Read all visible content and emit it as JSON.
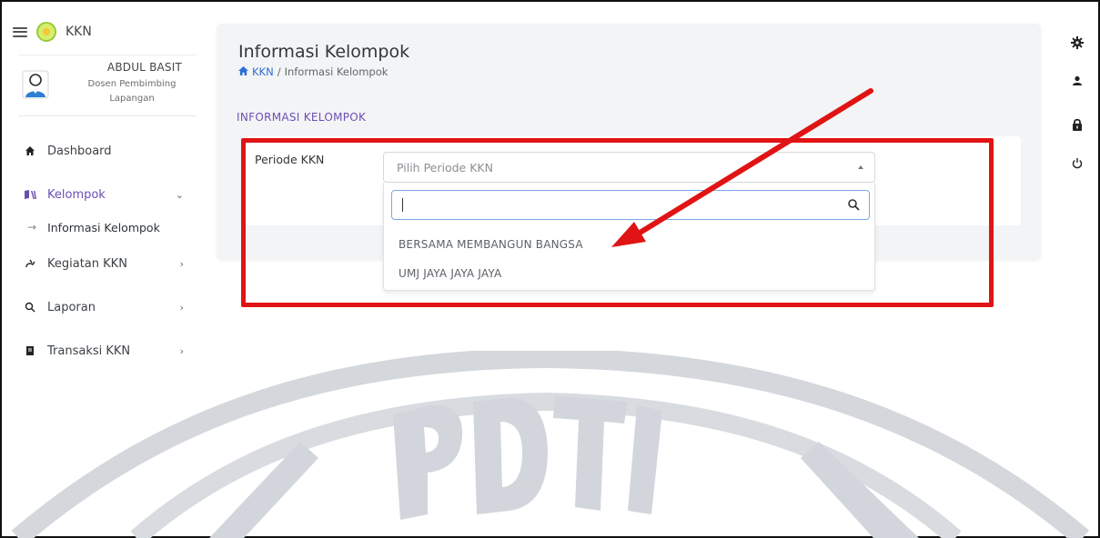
{
  "app": {
    "title": "KKN"
  },
  "profile": {
    "name": "ABDUL BASIT",
    "role": "Dosen Pembimbing Lapangan"
  },
  "sidebar": {
    "items": [
      {
        "label": "Dashboard",
        "icon": "home-icon",
        "has_chevron": false
      },
      {
        "label": "Kelompok",
        "icon": "group-icon",
        "has_chevron": true,
        "chevron": "down",
        "active": true
      },
      {
        "label": "Informasi Kelompok",
        "icon": "arrow-right-icon",
        "submenu": true
      },
      {
        "label": "Kegiatan KKN",
        "icon": "activity-icon",
        "has_chevron": true,
        "chevron": "right"
      },
      {
        "label": "Laporan",
        "icon": "search-icon",
        "has_chevron": true,
        "chevron": "right"
      },
      {
        "label": "Transaksi KKN",
        "icon": "book-icon",
        "has_chevron": true,
        "chevron": "right"
      }
    ]
  },
  "page": {
    "title": "Informasi Kelompok",
    "breadcrumb": {
      "root": "KKN",
      "separator": "/",
      "current": "Informasi Kelompok"
    },
    "section_title": "INFORMASI KELOMPOK"
  },
  "form": {
    "periode_label": "Periode KKN",
    "select_placeholder": "Pilih Periode KKN",
    "search_value": "",
    "options": [
      "BERSAMA MEMBANGUN BANGSA",
      "UMJ JAYA JAYA JAYA"
    ]
  },
  "right_toolbar": [
    "gear-icon",
    "user-icon",
    "lock-icon",
    "power-icon"
  ],
  "colors": {
    "accent_purple": "#6a4fb0",
    "link_blue": "#2a6fd6",
    "annotation_red": "#e01414",
    "card_bg": "#f3f4f6"
  },
  "watermark": {
    "text": "PDTI"
  }
}
